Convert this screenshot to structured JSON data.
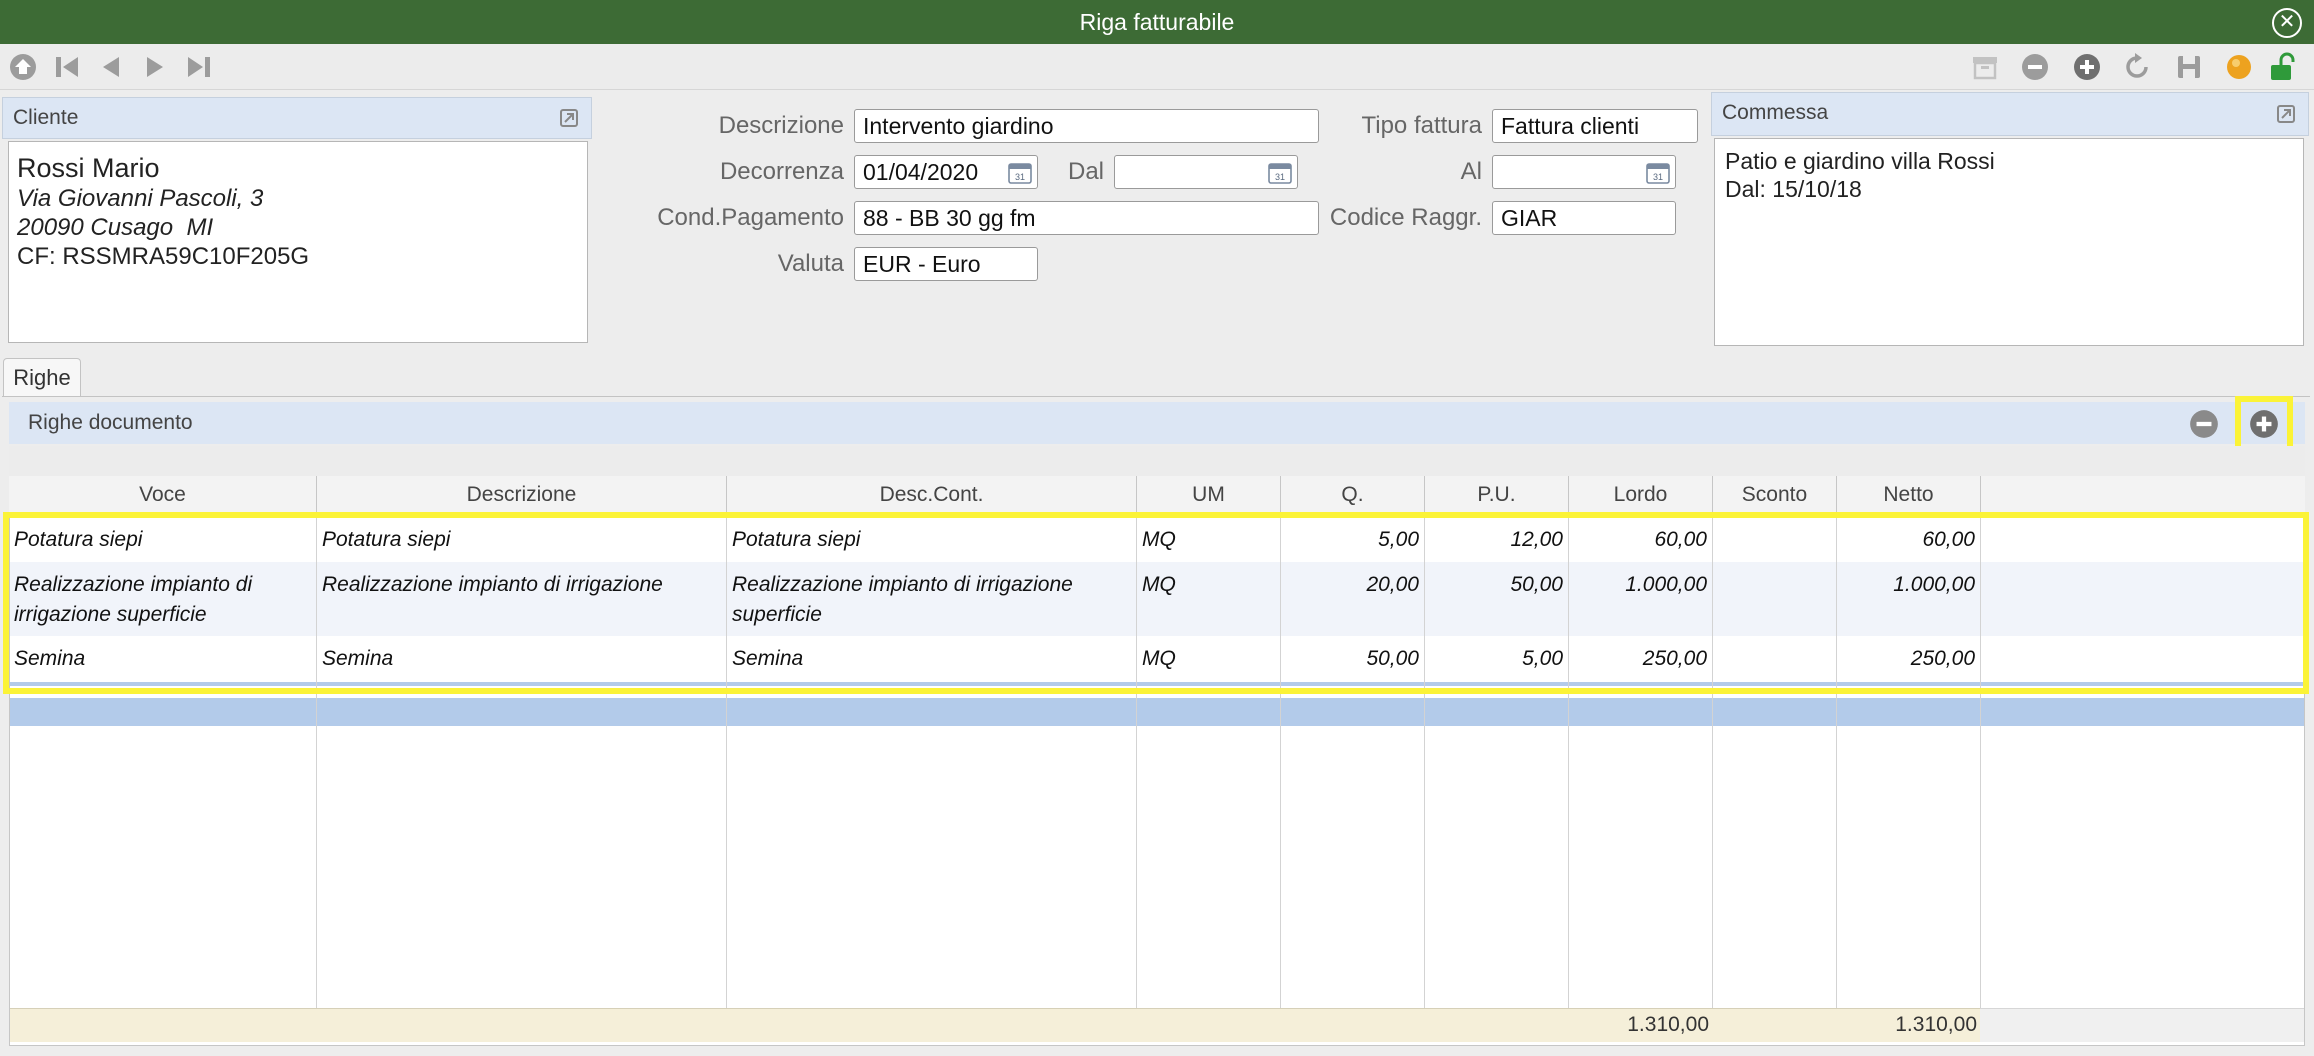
{
  "window": {
    "title": "Riga fatturabile",
    "close_icon": "close-icon"
  },
  "toolbar": {
    "left_icons": [
      "home-icon",
      "first-record-icon",
      "previous-record-icon",
      "next-record-icon",
      "last-record-icon"
    ],
    "right_icons": [
      "archive-icon",
      "remove-icon",
      "add-icon",
      "refresh-icon",
      "save-icon",
      "status-orange-icon",
      "unlock-icon"
    ]
  },
  "cliente": {
    "header": "Cliente",
    "name": "Rossi Mario",
    "address1": "Via Giovanni Pascoli, 3",
    "address2": "20090 Cusago  MI",
    "cf": "CF: RSSMRA59C10F205G"
  },
  "form": {
    "descrizione_label": "Descrizione",
    "descrizione_value": "Intervento giardino",
    "tipo_fattura_label": "Tipo fattura",
    "tipo_fattura_value": "Fattura clienti",
    "decorrenza_label": "Decorrenza",
    "decorrenza_value": "01/04/2020",
    "dal_label": "Dal",
    "dal_value": "",
    "al_label": "Al",
    "al_value": "",
    "cond_pagamento_label": "Cond.Pagamento",
    "cond_pagamento_value": "88 - BB 30 gg fm",
    "codice_raggr_label": "Codice Raggr.",
    "codice_raggr_value": "GIAR",
    "valuta_label": "Valuta",
    "valuta_value": "EUR - Euro"
  },
  "commessa": {
    "header": "Commessa",
    "line1": "Patio e giardino villa Rossi",
    "line2": "Dal: 15/10/18"
  },
  "tabs": [
    {
      "label": "Righe"
    }
  ],
  "righe": {
    "header": "Righe documento",
    "columns": [
      "Voce",
      "Descrizione",
      "Desc.Cont.",
      "UM",
      "Q.",
      "P.U.",
      "Lordo",
      "Sconto",
      "Netto"
    ],
    "rows": [
      {
        "voce": "Potatura siepi",
        "voce2": "",
        "descrizione": "Potatura siepi",
        "desc_cont": "Potatura siepi",
        "desc_cont2": "",
        "um": "MQ",
        "q": "5,00",
        "pu": "12,00",
        "lordo": "60,00",
        "sconto": "",
        "netto": "60,00"
      },
      {
        "voce": "Realizzazione impianto di",
        "voce2": "irrigazione superficie",
        "descrizione": "Realizzazione impianto di irrigazione",
        "desc_cont": "Realizzazione impianto di irrigazione",
        "desc_cont2": "superficie",
        "um": "MQ",
        "q": "20,00",
        "pu": "50,00",
        "lordo": "1.000,00",
        "sconto": "",
        "netto": "1.000,00"
      },
      {
        "voce": "Semina",
        "voce2": "",
        "descrizione": "Semina",
        "desc_cont": "Semina",
        "desc_cont2": "",
        "um": "MQ",
        "q": "50,00",
        "pu": "5,00",
        "lordo": "250,00",
        "sconto": "",
        "netto": "250,00"
      }
    ],
    "totals": {
      "lordo": "1.310,00",
      "netto": "1.310,00"
    }
  },
  "colors": {
    "titlebar": "#3d6b35",
    "highlight": "#fbf337",
    "panel_header": "#dce6f4",
    "selected_row": "#b3cbea",
    "totals_row": "#f5efd9"
  }
}
